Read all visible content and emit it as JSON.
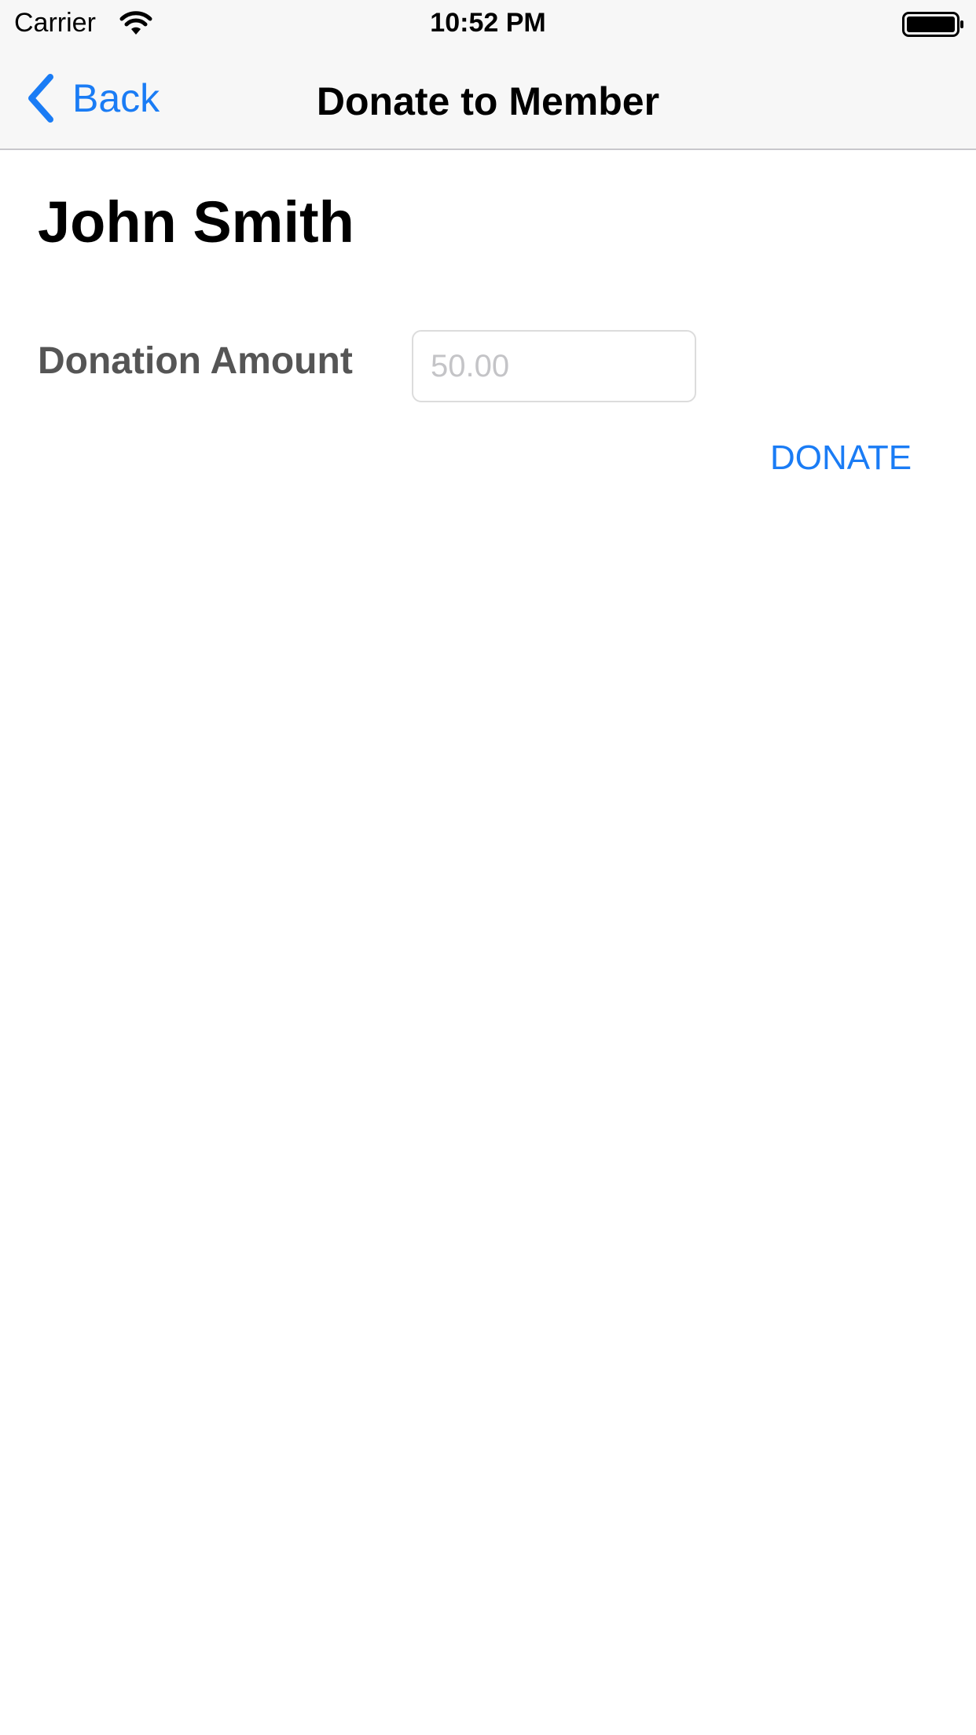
{
  "status_bar": {
    "carrier": "Carrier",
    "time": "10:52 PM",
    "wifi_icon": "wifi-icon",
    "battery_icon": "battery-full-icon"
  },
  "nav_bar": {
    "back_label": "Back",
    "back_icon": "chevron-left-icon",
    "title": "Donate to Member"
  },
  "content": {
    "member_name": "John Smith",
    "donation_amount_label": "Donation Amount",
    "donation_amount_value": "",
    "donation_amount_placeholder": "50.00",
    "donate_button_label": "DONATE"
  },
  "colors": {
    "accent": "#1a7cf5",
    "label_gray": "#555555",
    "bar_background": "#f7f7f7",
    "placeholder": "#c4c4c7"
  }
}
